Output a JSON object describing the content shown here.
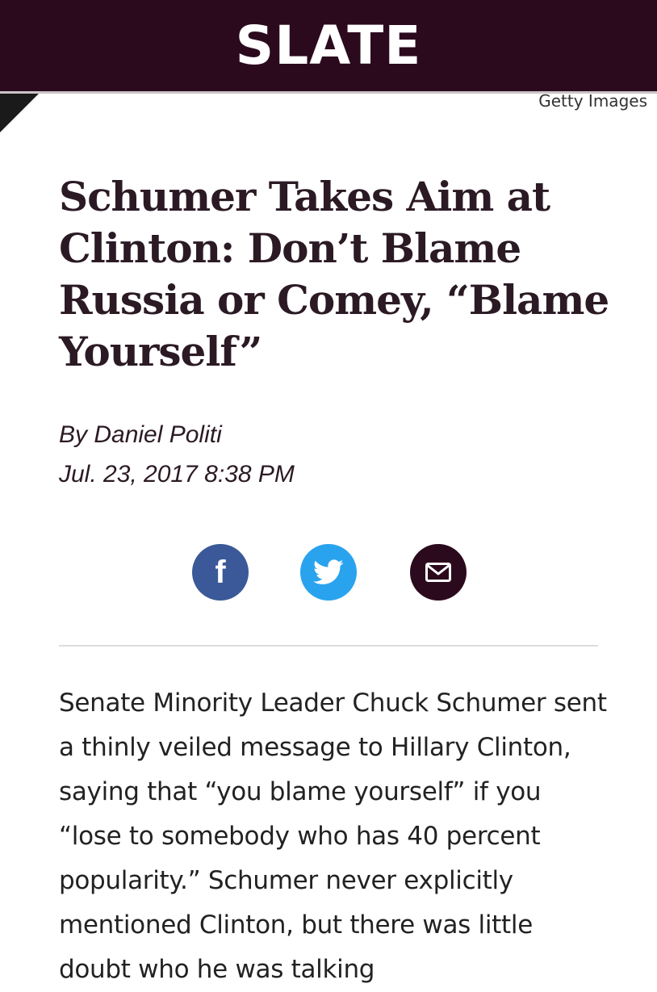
{
  "header": {
    "logo_text": "SLATE",
    "colors": {
      "background": "#2b0a1e",
      "logo": "#ffffff"
    }
  },
  "image": {
    "credit": "Getty Images"
  },
  "article": {
    "title": "Schumer Takes Aim at Clinton: Don’t Blame Russia or Comey, “Blame Yourself”",
    "byline": "By Daniel Politi",
    "date": "Jul. 23, 2017 8:38 PM",
    "body": "Senate Minority Leader Chuck Schumer sent a thinly veiled message to Hillary Clinton, saying that “you blame yourself” if you “lose to somebody who has 40 percent popularity.” Schumer never explicitly mentioned Clinton, but there was little doubt who he was talking"
  },
  "share": {
    "facebook": {
      "icon": "facebook-icon",
      "glyph": "f",
      "color": "#3b5998"
    },
    "twitter": {
      "icon": "twitter-icon",
      "color": "#2aa3ef"
    },
    "email": {
      "icon": "mail-icon",
      "color": "#2b0a1e"
    }
  }
}
